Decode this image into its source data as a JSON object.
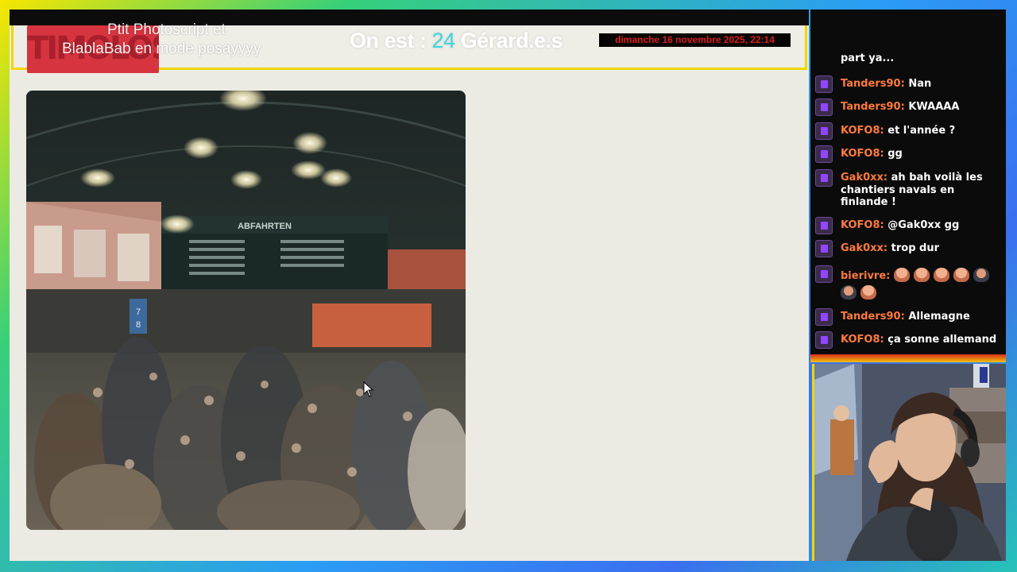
{
  "header": {
    "logo_text": "TIMOLOSSH",
    "overlay_line1": "Ptit Photoscript et",
    "overlay_line2": "BlablaBab en mode posayyyy",
    "viewers_prefix": "On est : ",
    "viewers_count": "24",
    "viewers_suffix": " Gérard.e.s",
    "datetime": "dimanche 16 novembre 2025, 22:14"
  },
  "photo": {
    "sign_text": "ABFAHRTEN",
    "platform_sign": "7 8"
  },
  "chat": {
    "cut_text": "part ya...",
    "messages": [
      {
        "user": "Tanders90:",
        "text": "Nan"
      },
      {
        "user": "Tanders90:",
        "text": "KWAAAA"
      },
      {
        "user": "KOFO8:",
        "text": "et l'année ?"
      },
      {
        "user": "KOFO8:",
        "text": "gg"
      },
      {
        "user": "Gak0xx:",
        "text": "ah bah voilà les chantiers navals en finlande !"
      },
      {
        "user": "KOFO8:",
        "text": "@Gak0xx gg"
      },
      {
        "user": "Gak0xx:",
        "text": "trop dur"
      },
      {
        "user": "bierivre:",
        "text": ""
      },
      {
        "user": "Tanders90:",
        "text": "Allemagne"
      },
      {
        "user": "KOFO8:",
        "text": "ça sonne allemand"
      }
    ]
  },
  "colors": {
    "accent_yellow": "#f2d600",
    "username": "#ff7a3d",
    "viewer_num": "#3fd7e0",
    "datetime_red": "#e01b1b"
  }
}
